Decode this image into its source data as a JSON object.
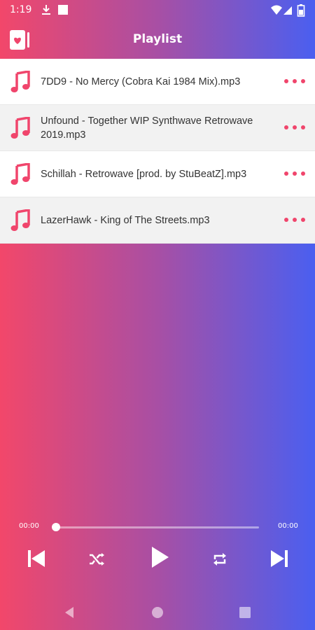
{
  "status_bar": {
    "time": "1:19",
    "icons": [
      "download-icon",
      "square-notification-icon",
      "wifi-icon",
      "signal-icon",
      "battery-icon"
    ]
  },
  "app_bar": {
    "title": "Playlist",
    "menu_icon": "music-library-icon"
  },
  "playlist": {
    "items": [
      {
        "title": "7DD9 - No Mercy (Cobra Kai 1984 Mix).mp3"
      },
      {
        "title": "Unfound - Together WIP Synthwave Retrowave 2019.mp3"
      },
      {
        "title": "Schillah - Retrowave [prod. by StuBeatZ].mp3"
      },
      {
        "title": "LazerHawk - King of The Streets.mp3"
      }
    ],
    "item_icon": "music-note-icon",
    "more_icon": "more-dots-icon"
  },
  "player": {
    "elapsed": "00:00",
    "duration": "00:00",
    "progress": 0,
    "controls": [
      "skip-previous-icon",
      "shuffle-icon",
      "play-icon",
      "repeat-icon",
      "skip-next-icon"
    ]
  },
  "nav_bar": {
    "icons": [
      "back-icon",
      "home-icon",
      "recents-icon"
    ]
  },
  "colors": {
    "accent": "#f0456c",
    "gradient_start": "#f2476a",
    "gradient_mid": "#a84fa4",
    "gradient_end": "#4a5ff0"
  }
}
